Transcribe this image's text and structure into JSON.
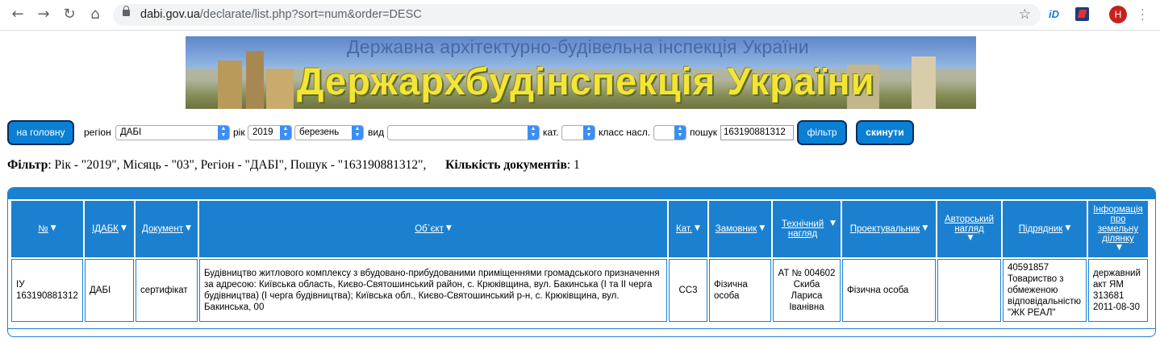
{
  "browser": {
    "url_host": "dabi.gov.ua",
    "url_path": "/declarate/list.php?sort=num&order=DESC",
    "profile_initial": "Н",
    "ext_label": "iD"
  },
  "banner": {
    "subtitle": "Державна архітектурно-будівельна інспекція України",
    "title": "Держархбудінспекція України"
  },
  "filters": {
    "home_button": "на головну",
    "region_label": "регіон",
    "region_value": "ДАБІ",
    "year_label": "рік",
    "year_value": "2019",
    "month_value": "березень",
    "type_label": "вид",
    "type_value": "",
    "cat_label": "кат.",
    "cat_value": "",
    "class_label": "класс насл.",
    "class_value": "",
    "search_label": "пошук",
    "search_value": "163190881312",
    "filter_button": "фільтр",
    "reset_button": "скинути"
  },
  "summary": {
    "filter_label": "Фільтр",
    "filter_text": ": Рік - \"2019\", Місяць - \"03\", Регіон - \"ДАБІ\", Пошук - \"163190881312\",",
    "count_label": "Кількість документів",
    "count_value": ": 1"
  },
  "table": {
    "headers": [
      "№",
      "ІДАБК",
      "Документ",
      "Об`єкт",
      "Кат.",
      "Замовник",
      "Технічний нагляд",
      "Проектувальник",
      "Авторський нагляд",
      "Підрядник",
      "Інформація про земельну ділянку"
    ],
    "rows": [
      {
        "num": "ІУ 163190881312",
        "idabk": "ДАБІ",
        "doc": "сертифікат",
        "object": "Будівництво житлового комплексу з вбудовано-прибудованими приміщеннями громадського призначення за адресою: Київська область, Києво-Святошинський район, с. Крюківщина, вул. Бакинська (І та ІІ черга будівництва) (І черга будівництва); Київська обл., Києво-Святошинський р-н, с. Крюківщина, вул. Бакинська, 00",
        "cat": "СС3",
        "customer": "Фізична особа",
        "supervision": "АТ № 004602 Скиба Лариса Іванівна",
        "designer": "Фізична особа",
        "author_supervision": "",
        "contractor": "40591857 Товариство з обмеженою відповідальністю \"ЖК РЕАЛ\"",
        "land": "державний акт ЯМ 313681 2011-08-30"
      }
    ]
  }
}
